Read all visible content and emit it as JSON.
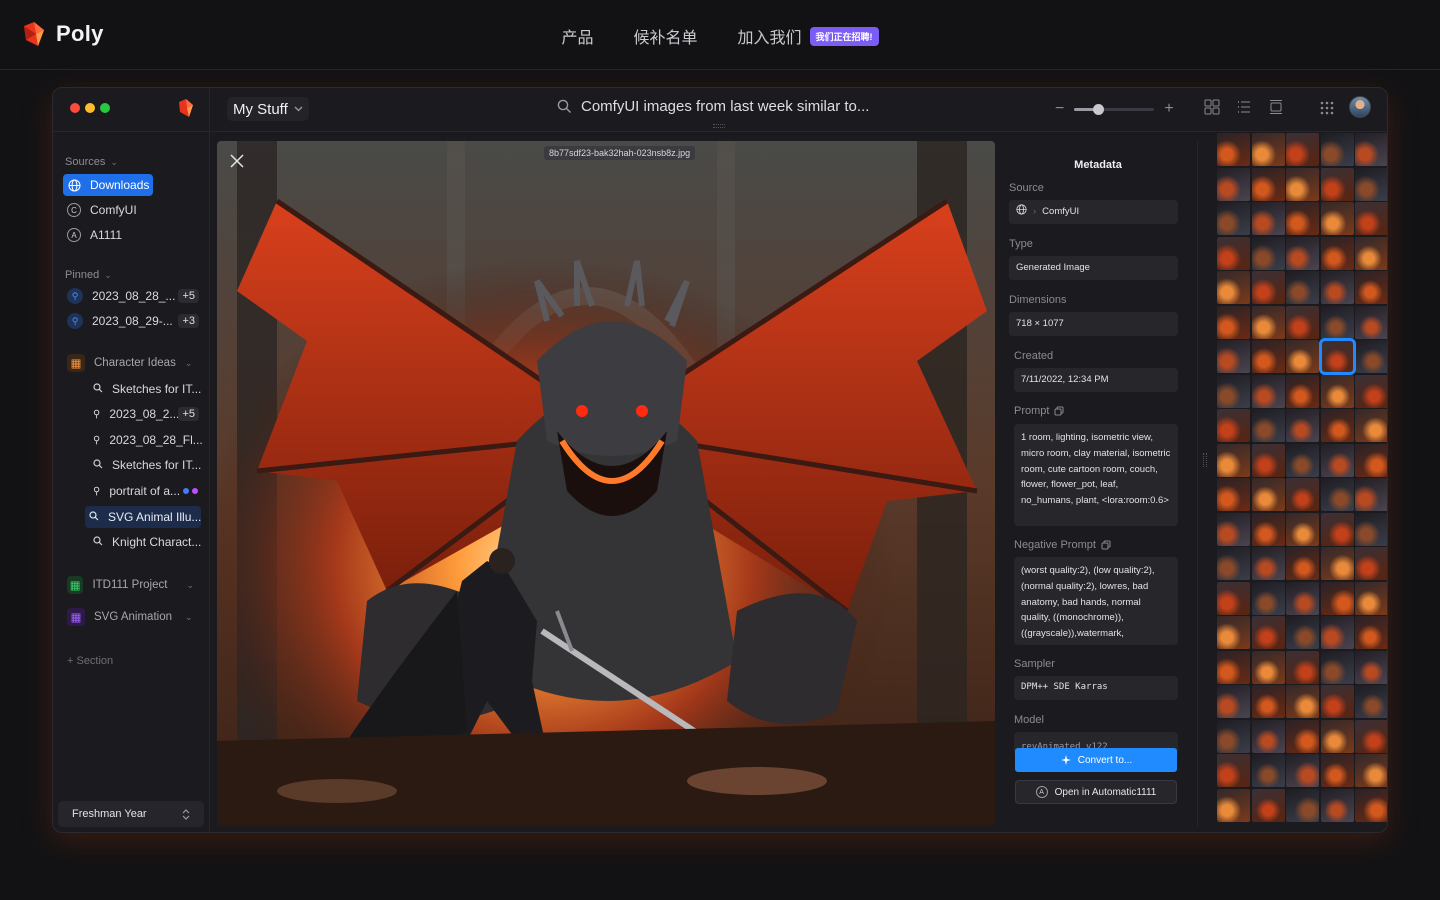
{
  "site": {
    "brand": "Poly",
    "nav": [
      "产品",
      "候补名单",
      "加入我们"
    ],
    "hiring_badge": "我们正在招聘!"
  },
  "toolbar": {
    "workspace": "My Stuff",
    "search_query": "ComfyUI images from last week similar to...",
    "zoom_level": 0.3
  },
  "sidebar": {
    "sources_title": "Sources",
    "sources": [
      {
        "label": "Downloads",
        "icon": "globe-icon",
        "active": true
      },
      {
        "label": "ComfyUI",
        "icon": "comfyui-icon"
      },
      {
        "label": "A1111",
        "icon": "a1111-icon"
      }
    ],
    "pinned_title": "Pinned",
    "pinned": [
      {
        "label": "2023_08_28_...",
        "count": "+5"
      },
      {
        "label": "2023_08_29-...",
        "count": "+3"
      }
    ],
    "character_ideas": {
      "title": "Character Ideas",
      "items": [
        {
          "label": "Sketches for IT...",
          "icon": "search-icon"
        },
        {
          "label": "2023_08_2...",
          "icon": "pin-icon",
          "count": "+5"
        },
        {
          "label": "2023_08_28_Fl...",
          "icon": "pin-icon"
        },
        {
          "label": "Sketches for IT...",
          "icon": "search-icon"
        },
        {
          "label": "portrait of a...",
          "icon": "pin-icon"
        },
        {
          "label": "SVG Animal Illu...",
          "icon": "search-icon",
          "selected": true
        },
        {
          "label": "Knight Charact...",
          "icon": "search-icon"
        }
      ]
    },
    "groups": [
      "ITD111 Project",
      "SVG Animation"
    ],
    "add_section": "+ Section",
    "footer_select": "Freshman Year"
  },
  "viewer": {
    "filename": "8b77sdf23-bak32hah-023nsb8z.jpg"
  },
  "metadata": {
    "title": "Metadata",
    "source_label": "Source",
    "source_value": "ComfyUI",
    "type_label": "Type",
    "type_value": "Generated Image",
    "dimensions_label": "Dimensions",
    "dimensions_value": "718 × 1077",
    "created_label": "Created",
    "created_value": "7/11/2022, 12:34 PM",
    "prompt_label": "Prompt",
    "prompt_value": "1 room, lighting, isometric view, micro room, clay material, isometric room, cute cartoon room, couch, flower, flower_pot, leaf, no_humans, plant, <lora:room:0.6>",
    "negative_label": "Negative Prompt",
    "negative_value": "(worst quality:2), (low quality:2), (normal quality:2), lowres, bad anatomy, bad hands, normal quality, ((monochrome)), ((grayscale)),watermark,",
    "sampler_label": "Sampler",
    "sampler_value": "DPM++ SDE Karras",
    "model_label": "Model",
    "model_value": "revAnimated_v122",
    "convert_button": "Convert to...",
    "open_button": "Open in Automatic1111"
  },
  "colors": {
    "accent": "#1f8bff",
    "brand_red": "#e8331f",
    "hiring": "#7b5cf5"
  }
}
